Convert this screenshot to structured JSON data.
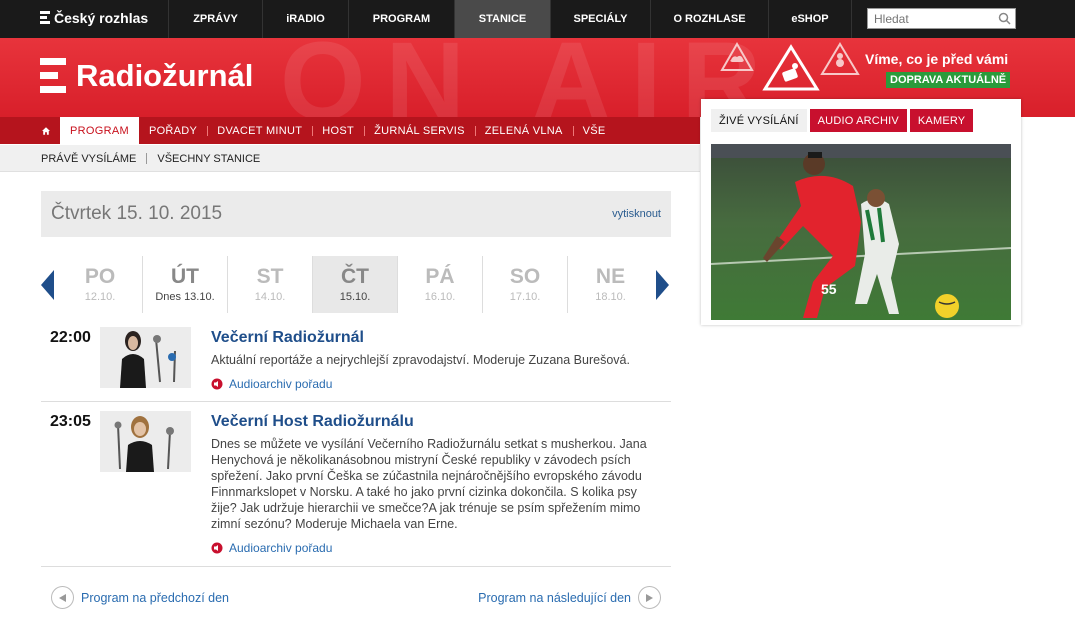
{
  "topbar": {
    "brand": "Český rozhlas",
    "nav": [
      {
        "label": "ZPRÁVY",
        "active": false
      },
      {
        "label": "iRADIO",
        "active": false
      },
      {
        "label": "PROGRAM",
        "active": false
      },
      {
        "label": "STANICE",
        "active": true
      },
      {
        "label": "SPECIÁLY",
        "active": false
      },
      {
        "label": "O ROZHLASE",
        "active": false
      },
      {
        "label": "eSHOP",
        "active": false
      }
    ],
    "search_placeholder": "Hledat"
  },
  "header": {
    "station": "Radiožurnál",
    "background_text": "ON AIR",
    "traffic_tagline": "Víme, co je před vámi",
    "traffic_badge": "DOPRAVA AKTUÁLNĚ"
  },
  "nav2": {
    "items": [
      "PROGRAM",
      "POŘADY",
      "DVACET MINUT",
      "HOST",
      "ŽURNÁL SERVIS",
      "ZELENÁ VLNA",
      "VŠE"
    ],
    "active": "PROGRAM"
  },
  "subnav": {
    "items": [
      "PRÁVĚ VYSÍLÁME",
      "VŠECHNY STANICE"
    ]
  },
  "datebox": {
    "date": "Čtvrtek 15. 10. 2015",
    "print_label": "vytisknout"
  },
  "days": [
    {
      "abbr": "PO",
      "date": "12.10.",
      "state": ""
    },
    {
      "abbr": "ÚT",
      "date": "Dnes 13.10.",
      "state": "today"
    },
    {
      "abbr": "ST",
      "date": "14.10.",
      "state": ""
    },
    {
      "abbr": "ČT",
      "date": "15.10.",
      "state": "active"
    },
    {
      "abbr": "PÁ",
      "date": "16.10.",
      "state": ""
    },
    {
      "abbr": "SO",
      "date": "17.10.",
      "state": ""
    },
    {
      "abbr": "NE",
      "date": "18.10.",
      "state": ""
    }
  ],
  "programs": [
    {
      "time": "22:00",
      "title": "Večerní Radiožurnál",
      "description": "Aktuální reportáže a nejrychlejší zpravodajství. Moderuje Zuzana Burešová.",
      "audio_label": "Audioarchiv pořadu"
    },
    {
      "time": "23:05",
      "title": "Večerní Host Radiožurnálu",
      "description": "Dnes se můžete ve vysílání Večerního Radiožurnálu setkat s musherkou. Jana Henychová je několikanásobnou mistryní České republiky v závodech psích spřežení. Jako první Češka se zúčastnila nejnáročnějšího evropského závodu Finnmarkslopet v Norsku. A také ho jako první cizinka dokončila. S kolika psy žije? Jak udržuje hierarchii ve smečce?A jak trénuje se psím spřežením mimo zimní sezónu? Moderuje Michaela van Erne.",
      "audio_label": "Audioarchiv pořadu"
    }
  ],
  "footer_nav": {
    "prev": "Program na předchozí den",
    "next": "Program na následující den"
  },
  "panel": {
    "tabs": [
      "ŽIVÉ VYSÍLÁNÍ",
      "AUDIO ARCHIV",
      "KAMERY"
    ],
    "active_tab": "ŽIVÉ VYSÍLÁNÍ",
    "player_number": "55"
  },
  "colors": {
    "brand_red": "#d81f2a",
    "nav_red": "#b5141d",
    "tab_red": "#c8102e",
    "link_blue": "#2a6cb0",
    "title_blue": "#1f4e8a",
    "badge_green": "#2a9b3b"
  }
}
